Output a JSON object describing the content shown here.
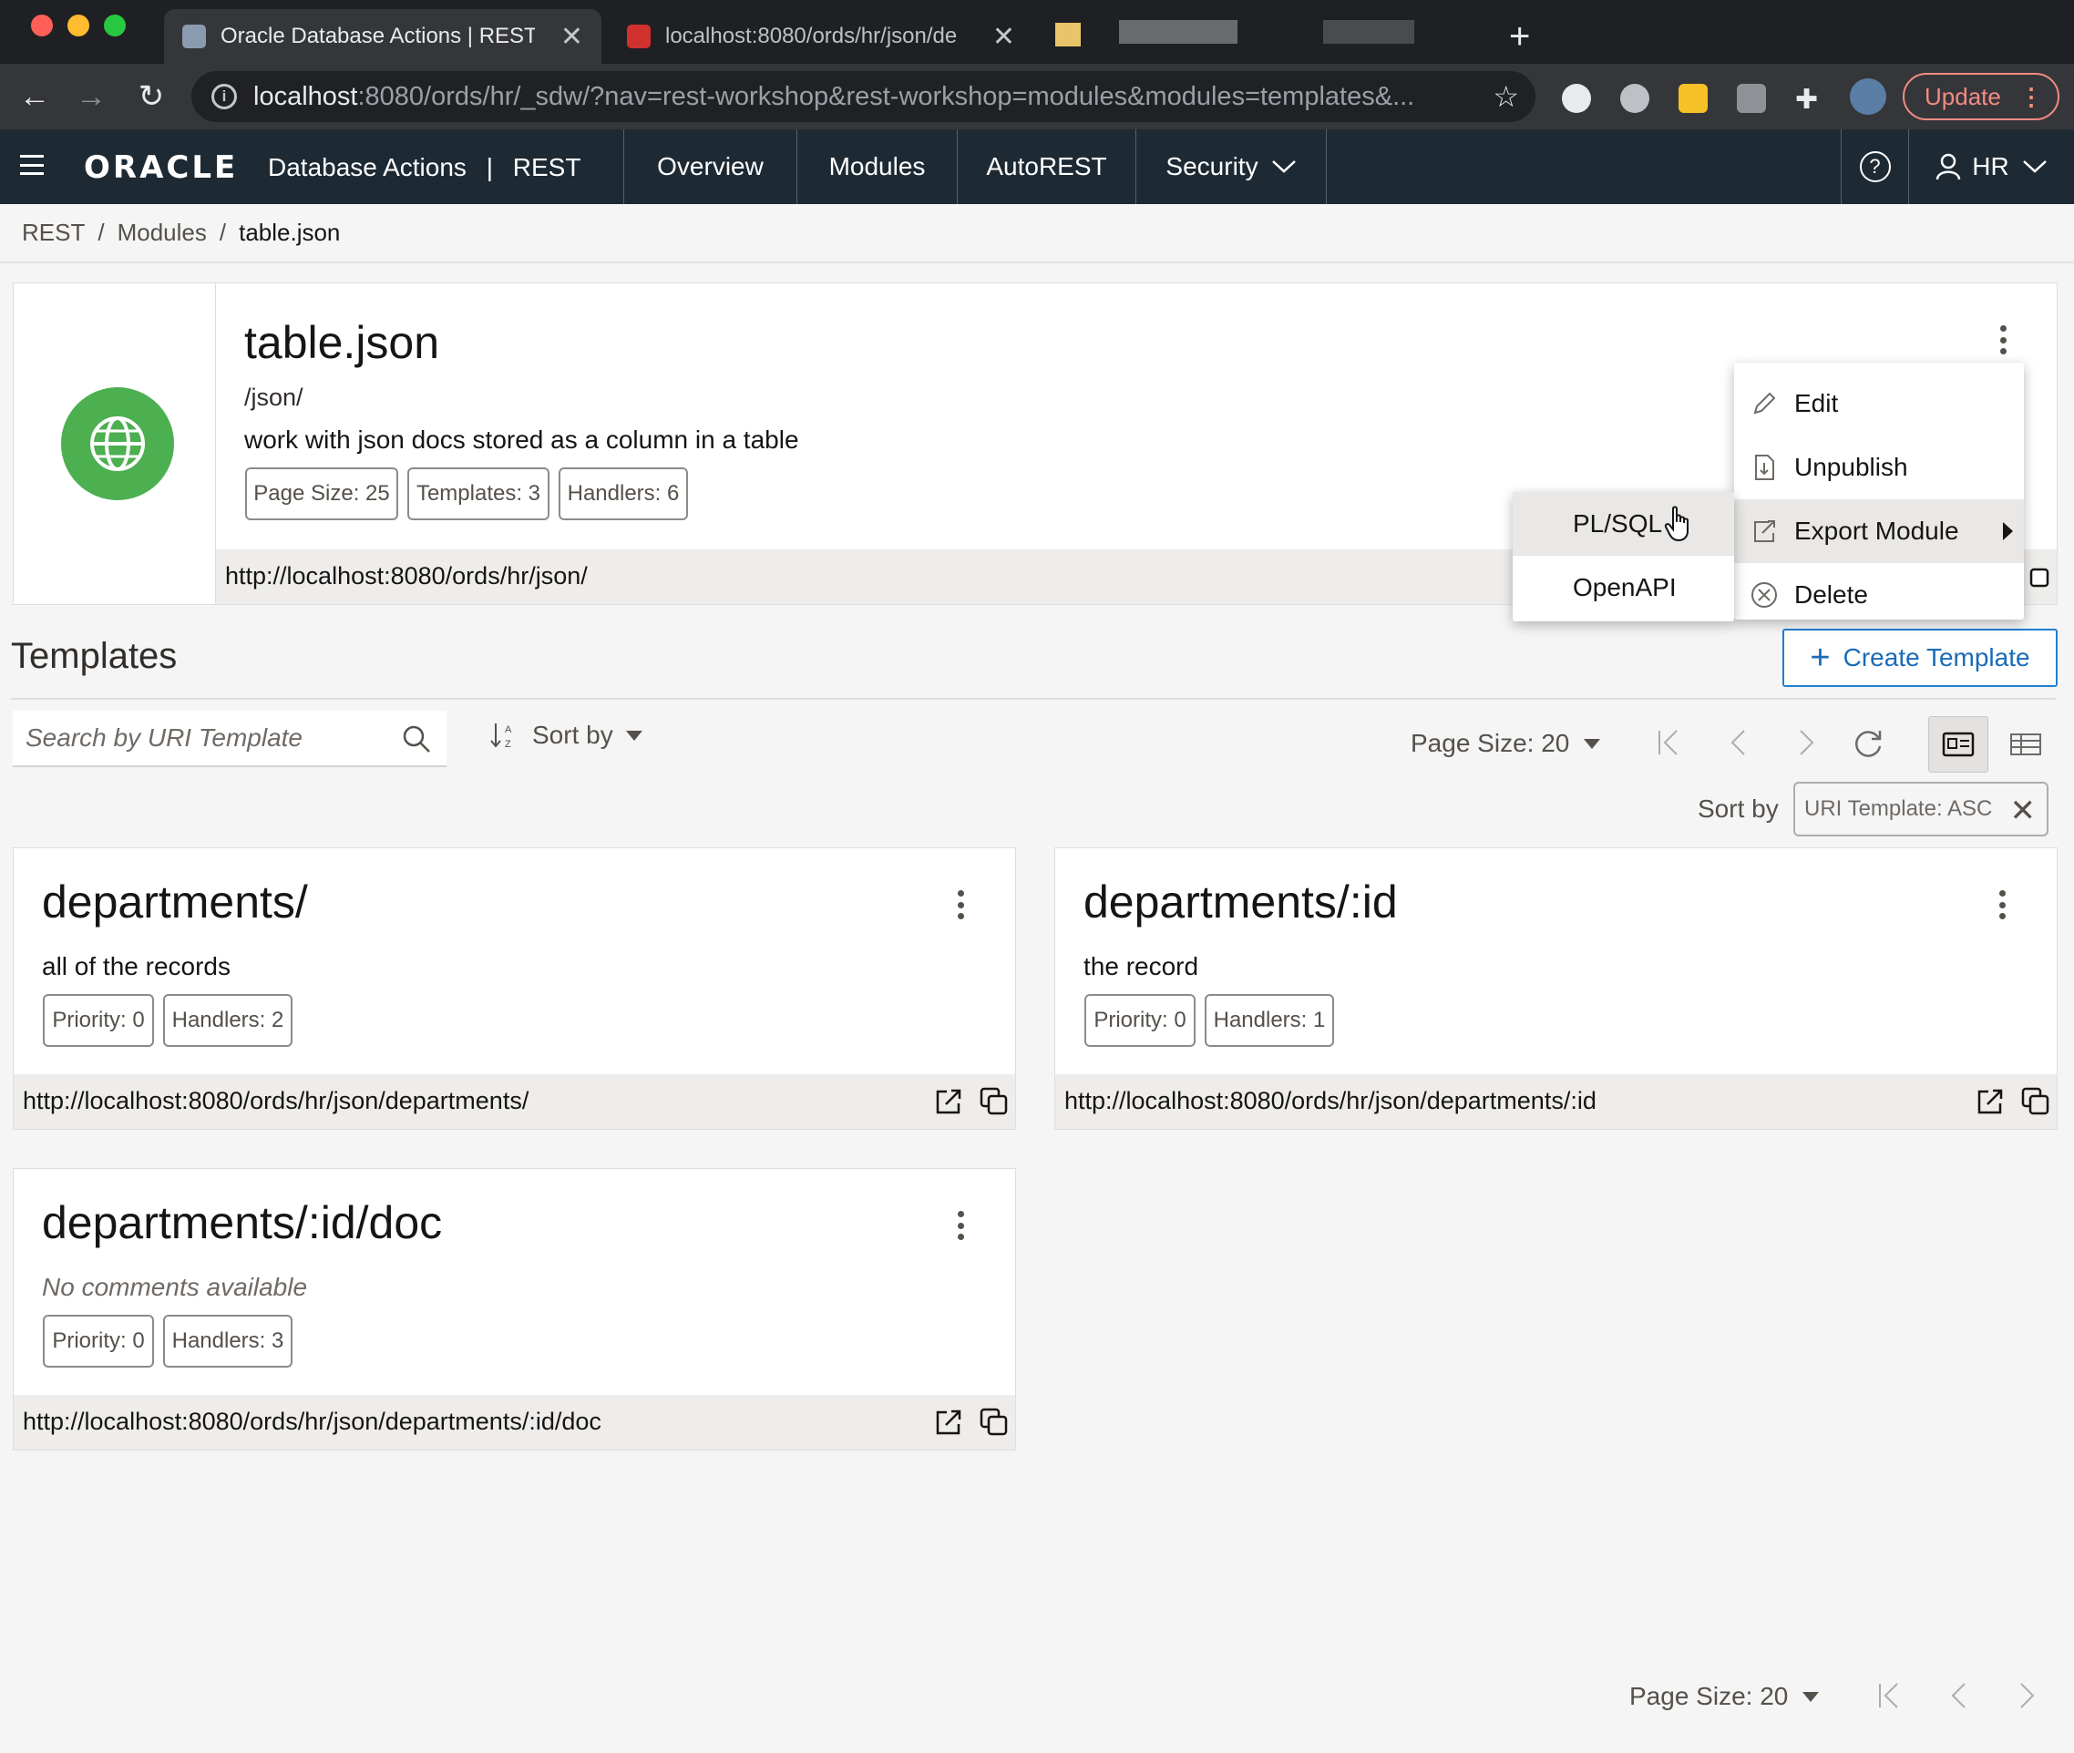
{
  "browser": {
    "tabs": [
      {
        "title": "Oracle Database Actions | REST",
        "close": "✕"
      },
      {
        "title": "localhost:8080/ords/hr/json/de",
        "close": "✕"
      }
    ],
    "new_tab": "+",
    "url_host": "localhost",
    "url_rest": ":8080/ords/hr/_sdw/?nav=rest-workshop&rest-workshop=modules&modules=templates&...",
    "update_label": "Update",
    "update_dots": "⋮"
  },
  "app": {
    "logo": "ORACLE",
    "product": "Database Actions",
    "divider": "|",
    "section": "REST",
    "nav": [
      "Overview",
      "Modules",
      "AutoREST",
      "Security"
    ],
    "help": "?",
    "user": "HR"
  },
  "breadcrumb": [
    "REST",
    "Modules",
    "table.json"
  ],
  "breadcrumb_sep": "/",
  "module": {
    "name": "table.json",
    "path": "/json/",
    "description": "work with json docs stored as a column in a table",
    "chips": [
      "Page Size: 25",
      "Templates: 3",
      "Handlers: 6"
    ],
    "url": "http://localhost:8080/ords/hr/json/"
  },
  "menu": {
    "items": [
      "Edit",
      "Unpublish",
      "Export Module",
      "Delete"
    ],
    "submenu": [
      "PL/SQL",
      "OpenAPI"
    ]
  },
  "templates": {
    "heading": "Templates",
    "create_label": "Create Template",
    "search_placeholder": "Search by URI Template",
    "sort_label": "Sort by",
    "page_size": "Page Size: 20",
    "sort_by_label": "Sort by",
    "sort_chip": "URI Template: ASC",
    "cards": [
      {
        "title": "departments/",
        "desc": "all of the records",
        "chips": [
          "Priority: 0",
          "Handlers: 2"
        ],
        "url": "http://localhost:8080/ords/hr/json/departments/"
      },
      {
        "title": "departments/:id",
        "desc": "the record",
        "chips": [
          "Priority: 0",
          "Handlers: 1"
        ],
        "url": "http://localhost:8080/ords/hr/json/departments/:id"
      },
      {
        "title": "departments/:id/doc",
        "desc": "No comments available",
        "chips": [
          "Priority: 0",
          "Handlers: 3"
        ],
        "url": "http://localhost:8080/ords/hr/json/departments/:id/doc"
      }
    ],
    "bottom_page_size": "Page Size: 20"
  },
  "colors": {
    "header_bg": "#1e2a33",
    "accent": "#227fd0",
    "globe": "#4caf50",
    "update": "#f28b82"
  },
  "icons": [
    "globe-icon",
    "search-icon",
    "pencil-icon",
    "unpublish-icon",
    "export-icon",
    "delete-icon",
    "open-new-window-icon",
    "copy-icon",
    "refresh-icon",
    "card-view-icon",
    "table-view-icon"
  ]
}
